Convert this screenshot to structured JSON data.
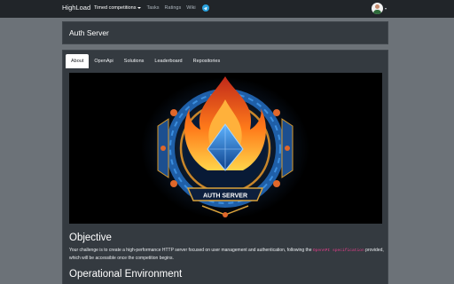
{
  "navbar": {
    "brand": "HighLoad",
    "links": [
      {
        "label": "Timed competitions",
        "active": true,
        "dropdown": true
      },
      {
        "label": "Tasks"
      },
      {
        "label": "Ratings"
      },
      {
        "label": "Wiki"
      }
    ],
    "telegram_icon": "telegram-icon",
    "accent": "#2aa3df"
  },
  "header": {
    "title": "Auth Server"
  },
  "tabs": [
    {
      "label": "About",
      "active": true
    },
    {
      "label": "OpenApi"
    },
    {
      "label": "Solutions"
    },
    {
      "label": "Leaderboard"
    },
    {
      "label": "Repositories"
    }
  ],
  "hero": {
    "banner_text": "AUTH SERVER"
  },
  "objective": {
    "title": "Objective",
    "text_before": "Your challenge is to create a high-performance HTTP server focused on user management and authentication, following the ",
    "code": "OpenAPI specification",
    "text_after": " provided, which will be accessible once the competition begins."
  },
  "environment": {
    "title": "Operational Environment"
  },
  "colors": {
    "page_bg": "#6c7278",
    "card_bg": "#343a40",
    "navbar_bg": "#212529",
    "code_color": "#e83e8c"
  }
}
